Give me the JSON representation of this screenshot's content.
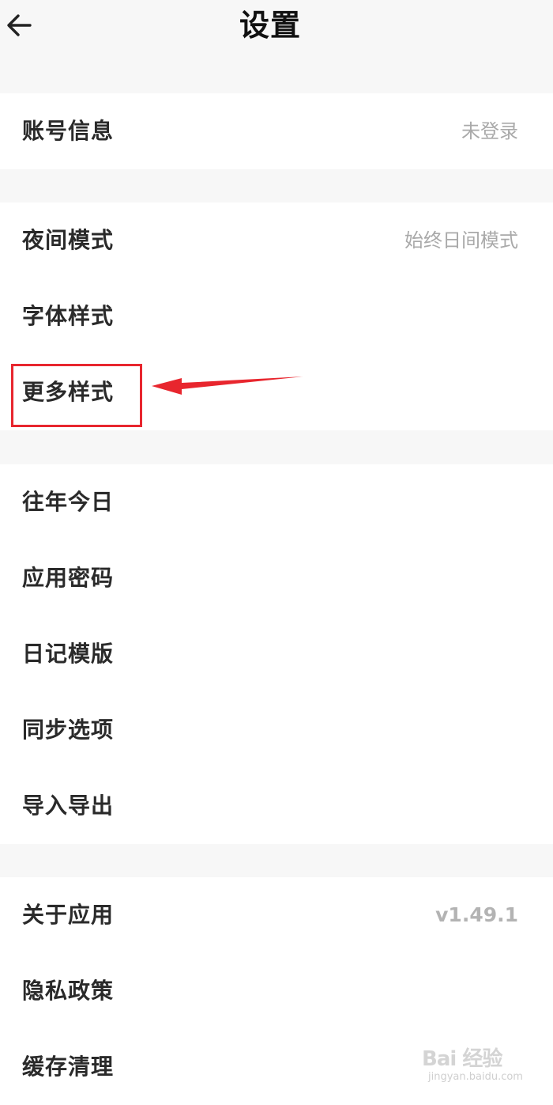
{
  "header": {
    "title": "设置",
    "back_icon": "arrow-left-icon"
  },
  "groups": [
    {
      "items": [
        {
          "label": "账号信息",
          "value": "未登录"
        }
      ]
    },
    {
      "items": [
        {
          "label": "夜间模式",
          "value": "始终日间模式"
        },
        {
          "label": "字体样式",
          "value": ""
        },
        {
          "label": "更多样式",
          "value": ""
        }
      ]
    },
    {
      "items": [
        {
          "label": "往年今日",
          "value": ""
        },
        {
          "label": "应用密码",
          "value": ""
        },
        {
          "label": "日记模版",
          "value": ""
        },
        {
          "label": "同步选项",
          "value": ""
        },
        {
          "label": "导入导出",
          "value": ""
        }
      ]
    },
    {
      "items": [
        {
          "label": "关于应用",
          "value": "v1.49.1"
        },
        {
          "label": "隐私政策",
          "value": ""
        },
        {
          "label": "缓存清理",
          "value": ""
        }
      ]
    }
  ],
  "annotation": {
    "color": "#e8262e"
  },
  "watermark": {
    "brand": "Bai 经验",
    "url": "jingyan.baidu.com"
  }
}
